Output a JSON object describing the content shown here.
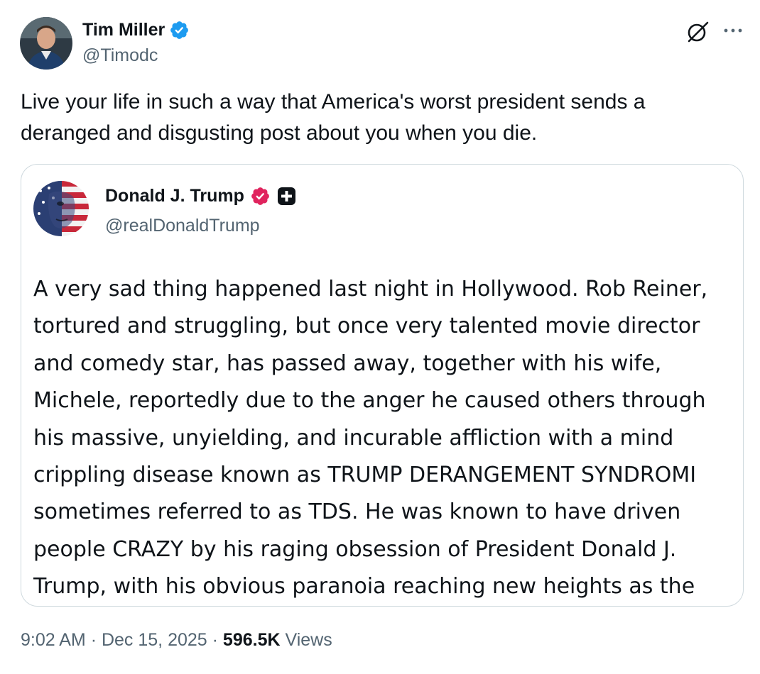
{
  "tweet": {
    "author_name": "Tim Miller",
    "author_handle": "@Timodc",
    "author_avatar": "profile-photo",
    "verified_icon": "verified-badge-icon",
    "verified_color": "#1d9bf0",
    "text": "Live your life in such a way that America's worst president sends a deranged and disgusting post about you when you die."
  },
  "header_icons": {
    "grok": "grok-icon",
    "more": "more-options-icon"
  },
  "quote": {
    "author_name": "Donald J. Trump",
    "author_handle": "@realDonaldTrump",
    "author_avatar": "american-flag-portrait",
    "badge_icon": "verified-badge-icon",
    "badge_color": "#e0245e",
    "plus_icon": "plus-icon",
    "lines": [
      "A very sad thing happened last night in Hollywood. Rob Reiner,",
      "tortured and struggling, but once very talented movie director",
      "and comedy star, has passed away, together with his wife,",
      "Michele, reportedly due to the anger he caused others through",
      "his massive, unyielding, and incurable affliction with a mind",
      "crippling disease known as TRUMP DERANGEMENT SYNDROMI",
      "sometimes referred to as TDS. He was known to have driven",
      "people CRAZY by his raging obsession of President Donald J.",
      "Trump, with his obvious paranoia reaching new heights as the"
    ]
  },
  "meta": {
    "time": "9:02 AM",
    "separator": "·",
    "date": "Dec 15, 2025",
    "views_count": "596.5K",
    "views_label": "Views"
  },
  "colors": {
    "text_primary": "#0f1419",
    "text_secondary": "#536471",
    "border": "#cfd9de"
  }
}
